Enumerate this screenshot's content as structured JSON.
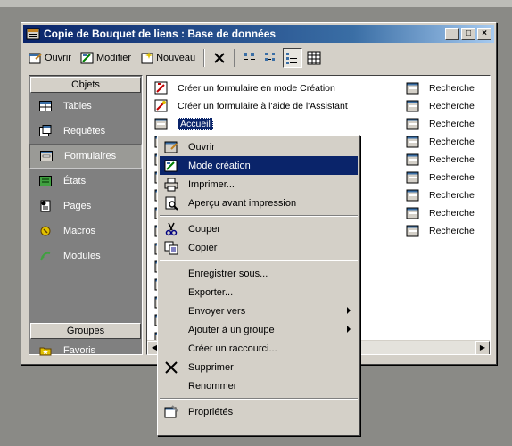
{
  "window": {
    "title": "Copie de Bouquet de liens : Base de données",
    "buttons": {
      "minimize": "_",
      "maximize": "□",
      "close": "×"
    }
  },
  "toolbar": {
    "open_label": "Ouvrir",
    "modify_label": "Modifier",
    "new_label": "Nouveau"
  },
  "sidebar": {
    "objects_header": "Objets",
    "items": [
      {
        "label": "Tables",
        "icon": "table-icon"
      },
      {
        "label": "Requêtes",
        "icon": "query-icon"
      },
      {
        "label": "Formulaires",
        "icon": "form-icon",
        "active": true
      },
      {
        "label": "États",
        "icon": "report-icon"
      },
      {
        "label": "Pages",
        "icon": "page-icon"
      },
      {
        "label": "Macros",
        "icon": "macro-icon"
      },
      {
        "label": "Modules",
        "icon": "module-icon"
      }
    ],
    "groups_header": "Groupes",
    "groups": [
      {
        "label": "Favoris",
        "icon": "favorites-icon"
      }
    ]
  },
  "list": {
    "left": [
      {
        "label": "Créer un formulaire en mode Création"
      },
      {
        "label": "Créer un formulaire à l'aide de l'Assistant"
      },
      {
        "label": "Accueil",
        "selected": true
      }
    ],
    "right": [
      {
        "label": "Recherche"
      },
      {
        "label": "Recherche"
      },
      {
        "label": "Recherche"
      },
      {
        "label": "Recherche"
      },
      {
        "label": "Recherche"
      },
      {
        "label": "Recherche"
      },
      {
        "label": "Recherche"
      },
      {
        "label": "Recherche"
      },
      {
        "label": "Recherche"
      }
    ]
  },
  "context_menu": {
    "items": [
      {
        "label": "Ouvrir",
        "icon": "open-form-icon"
      },
      {
        "label": "Mode création",
        "icon": "design-mode-icon",
        "highlighted": true
      },
      {
        "label": "Imprimer...",
        "icon": "print-icon"
      },
      {
        "label": "Aperçu avant impression",
        "icon": "print-preview-icon"
      },
      {
        "label": "Couper",
        "icon": "cut-icon",
        "sep_before": true
      },
      {
        "label": "Copier",
        "icon": "copy-icon"
      },
      {
        "label": "Enregistrer sous...",
        "sep_before": true
      },
      {
        "label": "Exporter..."
      },
      {
        "label": "Envoyer vers",
        "submenu": true
      },
      {
        "label": "Ajouter à un groupe",
        "submenu": true
      },
      {
        "label": "Créer un raccourci..."
      },
      {
        "label": "Supprimer",
        "icon": "delete-icon"
      },
      {
        "label": "Renommer"
      },
      {
        "label": "Propriétés",
        "icon": "properties-icon",
        "sep_before": true
      }
    ]
  }
}
